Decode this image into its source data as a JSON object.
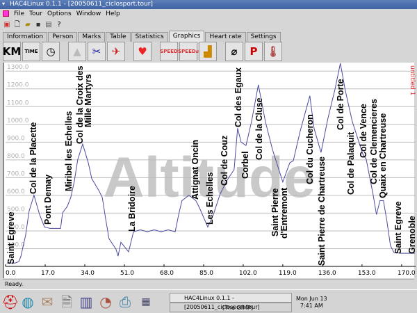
{
  "window": {
    "title": "HAC4Linux 0.1.1 - [20050611_ciclosport.tour]"
  },
  "menu": [
    "File",
    "Tour",
    "Options",
    "Window",
    "Help"
  ],
  "tabs": [
    "Information",
    "Person",
    "Marks",
    "Table",
    "Statistics",
    "Graphics",
    "Heart rate",
    "Settings"
  ],
  "active_tab": "Graphics",
  "iconbar": [
    {
      "icon": "km-icon",
      "label": "KM"
    },
    {
      "icon": "time-icon",
      "label": "TIME"
    },
    {
      "icon": "clock-icon",
      "label": "◷"
    },
    {
      "icon": "altitude-icon",
      "label": "▲"
    },
    {
      "icon": "cyclist-icon",
      "label": "✂"
    },
    {
      "icon": "climb-icon",
      "label": "✈"
    },
    {
      "icon": "heart-icon",
      "label": "♥"
    },
    {
      "icon": "speed-icon",
      "label": "SPEED"
    },
    {
      "icon": "avg-speed-icon",
      "label": "SPEED⌀"
    },
    {
      "icon": "cadence-icon",
      "label": "▟"
    },
    {
      "icon": "average-icon",
      "label": "⌀"
    },
    {
      "icon": "power-icon",
      "label": "P"
    },
    {
      "icon": "temperature-icon",
      "label": "🌡"
    }
  ],
  "chart_data": {
    "type": "area",
    "watermark": "Altitude",
    "series_label": "untitled 1",
    "xlim": [
      0,
      176
    ],
    "ylim": [
      200,
      1340
    ],
    "x_ticks": [
      "0.0",
      "17.0",
      "34.0",
      "51.0",
      "68.0",
      "85.0",
      "102.0",
      "119.0",
      "136.0",
      "153.0",
      "170.0"
    ],
    "y_ticks": [
      "300.0",
      "400.0",
      "500.0",
      "600.0",
      "700.0",
      "800.0",
      "900.0",
      "1000.0",
      "1100.0",
      "1200.0",
      "1300.0"
    ],
    "grid": true,
    "line_color": "#4a4aa0",
    "km": [
      0.6,
      4.2,
      5.7,
      6.6,
      8.6,
      10.1,
      12.2,
      14.6,
      16.7,
      19.1,
      23.6,
      24.5,
      26.5,
      28.0,
      29.5,
      31.0,
      33.1,
      35.5,
      37.0,
      40.0,
      41.5,
      42.9,
      44.4,
      47.4,
      48.3,
      49.5,
      50.7,
      52.8,
      54.9,
      57.9,
      60.8,
      63.8,
      66.8,
      69.8,
      72.8,
      74.3,
      75.7,
      78.7,
      81.7,
      83.2,
      86.8,
      89.2,
      92.1,
      95.1,
      98.1,
      99.6,
      101.1,
      103.2,
      105.6,
      108.5,
      111.5,
      114.5,
      119.0,
      122.0,
      123.5,
      126.4,
      130.6,
      132.4,
      135.4,
      138.4,
      141.3,
      143.7,
      145.8,
      148.8,
      153.3,
      154.8,
      157.7,
      159.2,
      160.7,
      162.2,
      163.7,
      165.2,
      166.7,
      169.7,
      175.6
    ],
    "altitude": [
      219,
      219,
      227,
      258,
      375,
      511,
      601,
      492,
      422,
      414,
      414,
      503,
      538,
      589,
      678,
      803,
      889,
      784,
      694,
      628,
      589,
      472,
      356,
      297,
      258,
      336,
      317,
      282,
      395,
      406,
      395,
      406,
      395,
      406,
      395,
      492,
      570,
      601,
      570,
      531,
      422,
      492,
      608,
      686,
      745,
      978,
      900,
      881,
      1017,
      1223,
      1017,
      861,
      675,
      784,
      795,
      959,
      1161,
      978,
      842,
      1036,
      1192,
      1344,
      1192,
      1017,
      834,
      803,
      608,
      492,
      570,
      570,
      453,
      317,
      278,
      274,
      274
    ],
    "waypoints": [
      [
        "Saint Egreve"
      ],
      [
        "Col de la Placette"
      ],
      [
        "Pont Demay"
      ],
      [
        "Miribel les Echelles"
      ],
      [
        "Col de la Croix des",
        "Mille Martyrs"
      ],
      [
        "La Bridoire"
      ],
      [
        "Attignat Oncin"
      ],
      [
        "Les Echelles"
      ],
      [
        "Col de Couz"
      ],
      [
        "Col des Egaux"
      ],
      [
        "Corbel"
      ],
      [
        "Col de la Cluse"
      ],
      [
        "Saint Pierre",
        "d'Entremont"
      ],
      [
        "Col du Cucheron"
      ],
      [
        "Saint Pierre de Chartreuse"
      ],
      [
        "Col de Porte"
      ],
      [
        "Col de Palaquit"
      ],
      [
        "Col de Vence"
      ],
      [
        "Col de Clemencieres"
      ],
      [
        "Quaix en Chartreuse"
      ],
      [
        "Saint Egreve"
      ],
      [
        "Grenoble"
      ]
    ]
  },
  "status": "Ready.",
  "taskbar": {
    "tasks": [
      "HAC4Linux 0.1.1 - [20050611_ciclosport.tour]",
      "[The GIMP]"
    ],
    "date": "Mon Jun 13",
    "time": "7:41 AM"
  }
}
